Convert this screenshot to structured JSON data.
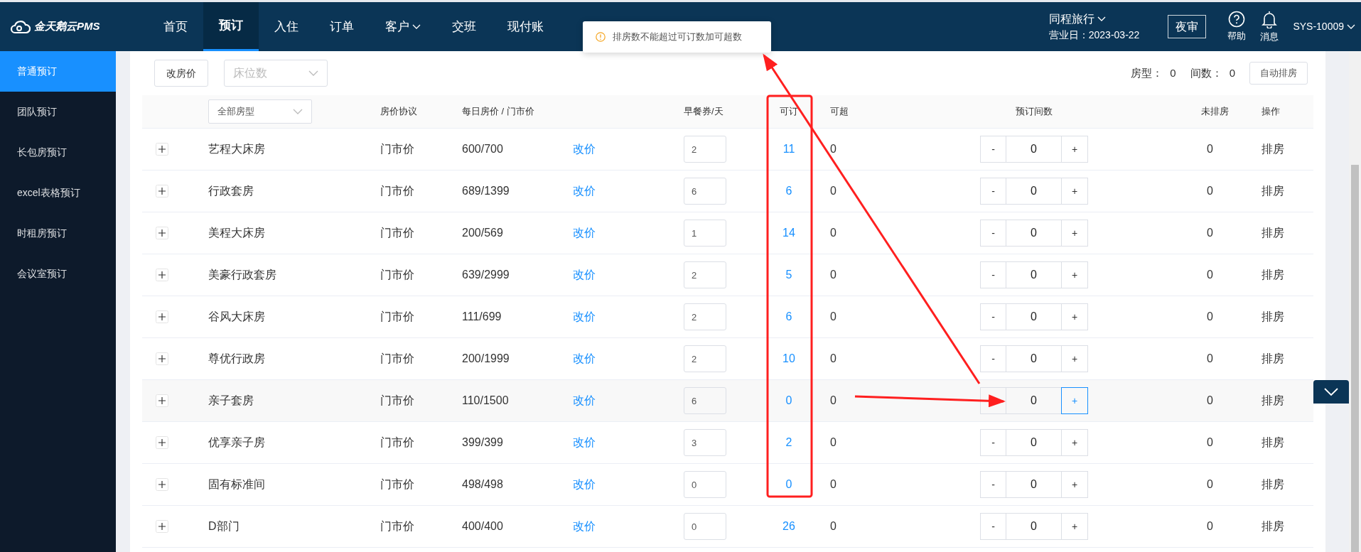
{
  "brand": {
    "name": "金天鹅云PMS"
  },
  "nav": [
    {
      "label": "首页",
      "selected": false,
      "dropdown": false
    },
    {
      "label": "预订",
      "selected": true,
      "dropdown": false
    },
    {
      "label": "入住",
      "selected": false,
      "dropdown": false
    },
    {
      "label": "订单",
      "selected": false,
      "dropdown": false
    },
    {
      "label": "客户",
      "selected": false,
      "dropdown": true
    },
    {
      "label": "交班",
      "selected": false,
      "dropdown": false
    },
    {
      "label": "现付账",
      "selected": false,
      "dropdown": false
    }
  ],
  "hotel": {
    "name": "同程旅行",
    "business_day": "营业日：2023-03-22"
  },
  "night_audit_button": "夜审",
  "help": "帮助",
  "messages": "消息",
  "user": "SYS-10009",
  "toast": {
    "message": "排房数不能超过可订数加可超数"
  },
  "sidebar": {
    "items": [
      {
        "label": "普通预订",
        "selected": true
      },
      {
        "label": "团队预订",
        "selected": false
      },
      {
        "label": "长包房预订",
        "selected": false
      },
      {
        "label": "excel表格预订",
        "selected": false
      },
      {
        "label": "时租房预订",
        "selected": false
      },
      {
        "label": "会议室预订",
        "selected": false
      }
    ]
  },
  "toolbar": {
    "change_price_button": "改房价",
    "bed_select_placeholder": "床位数",
    "room_type_label": "房型：",
    "room_type_count": "0",
    "rooms_label": "间数：",
    "rooms_count": "0",
    "auto_assign_button": "自动排房"
  },
  "table": {
    "room_type_filter": "全部房型",
    "decrement_label": "-",
    "increment_label": "+",
    "columns": [
      "房价协议",
      "每日房价 / 门市价",
      "早餐券/天",
      "可订",
      "可超",
      "预订间数",
      "未排房",
      "操作"
    ],
    "rows": [
      {
        "name": "艺程大床房",
        "agreement": "门市价",
        "price": "600/700",
        "change": "改价",
        "breakfast": "2",
        "available": "11",
        "overbook": "0",
        "count": "0",
        "unassigned": "0",
        "action": "排房",
        "hovered": false
      },
      {
        "name": "行政套房",
        "agreement": "门市价",
        "price": "689/1399",
        "change": "改价",
        "breakfast": "6",
        "available": "6",
        "overbook": "0",
        "count": "0",
        "unassigned": "0",
        "action": "排房",
        "hovered": false
      },
      {
        "name": "美程大床房",
        "agreement": "门市价",
        "price": "200/569",
        "change": "改价",
        "breakfast": "1",
        "available": "14",
        "overbook": "0",
        "count": "0",
        "unassigned": "0",
        "action": "排房",
        "hovered": false
      },
      {
        "name": "美豪行政套房",
        "agreement": "门市价",
        "price": "639/2999",
        "change": "改价",
        "breakfast": "2",
        "available": "5",
        "overbook": "0",
        "count": "0",
        "unassigned": "0",
        "action": "排房",
        "hovered": false
      },
      {
        "name": "谷风大床房",
        "agreement": "门市价",
        "price": "111/699",
        "change": "改价",
        "breakfast": "2",
        "available": "6",
        "overbook": "0",
        "count": "0",
        "unassigned": "0",
        "action": "排房",
        "hovered": false
      },
      {
        "name": "尊优行政房",
        "agreement": "门市价",
        "price": "200/1999",
        "change": "改价",
        "breakfast": "2",
        "available": "10",
        "overbook": "0",
        "count": "0",
        "unassigned": "0",
        "action": "排房",
        "hovered": false
      },
      {
        "name": "亲子套房",
        "agreement": "门市价",
        "price": "110/1500",
        "change": "改价",
        "breakfast": "6",
        "available": "0",
        "overbook": "0",
        "count": "0",
        "unassigned": "0",
        "action": "排房",
        "hovered": true
      },
      {
        "name": "优享亲子房",
        "agreement": "门市价",
        "price": "399/399",
        "change": "改价",
        "breakfast": "3",
        "available": "2",
        "overbook": "0",
        "count": "0",
        "unassigned": "0",
        "action": "排房",
        "hovered": false
      },
      {
        "name": "固有标准间",
        "agreement": "门市价",
        "price": "498/498",
        "change": "改价",
        "breakfast": "0",
        "available": "0",
        "overbook": "0",
        "count": "0",
        "unassigned": "0",
        "action": "排房",
        "hovered": false
      },
      {
        "name": "D部门",
        "agreement": "门市价",
        "price": "400/400",
        "change": "改价",
        "breakfast": "0",
        "available": "26",
        "overbook": "0",
        "count": "0",
        "unassigned": "0",
        "action": "排房",
        "hovered": false
      }
    ]
  }
}
